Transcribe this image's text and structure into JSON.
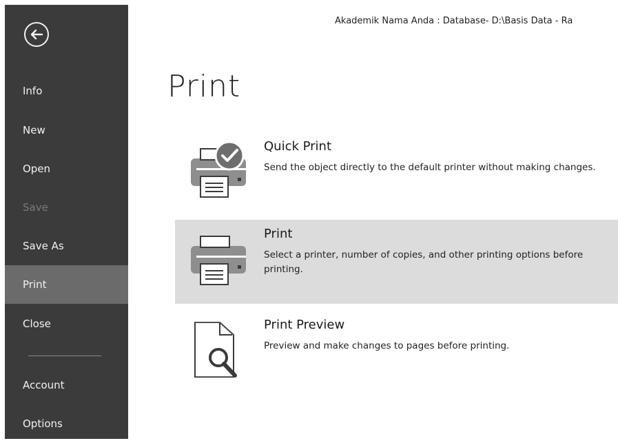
{
  "window": {
    "title": "Akademik Nama Anda : Database- D:\\Basis Data - Ra"
  },
  "sidebar": {
    "items": [
      {
        "label": "Info",
        "enabled": true,
        "selected": false
      },
      {
        "label": "New",
        "enabled": true,
        "selected": false
      },
      {
        "label": "Open",
        "enabled": true,
        "selected": false
      },
      {
        "label": "Save",
        "enabled": false,
        "selected": false
      },
      {
        "label": "Save As",
        "enabled": true,
        "selected": false
      },
      {
        "label": "Print",
        "enabled": true,
        "selected": true
      },
      {
        "label": "Close",
        "enabled": true,
        "selected": false
      },
      {
        "label": "Account",
        "enabled": true,
        "selected": false
      },
      {
        "label": "Options",
        "enabled": true,
        "selected": false
      }
    ]
  },
  "main": {
    "heading": "Print",
    "options": [
      {
        "title": "Quick Print",
        "description": "Send the object directly to the default printer without making changes.",
        "icon": "printer-check-icon",
        "highlighted": false
      },
      {
        "title": "Print",
        "description": "Select a printer, number of copies, and other printing options before printing.",
        "icon": "printer-icon",
        "highlighted": true
      },
      {
        "title": "Print Preview",
        "description": "Preview and make changes to pages before printing.",
        "icon": "print-preview-icon",
        "highlighted": false
      }
    ]
  }
}
